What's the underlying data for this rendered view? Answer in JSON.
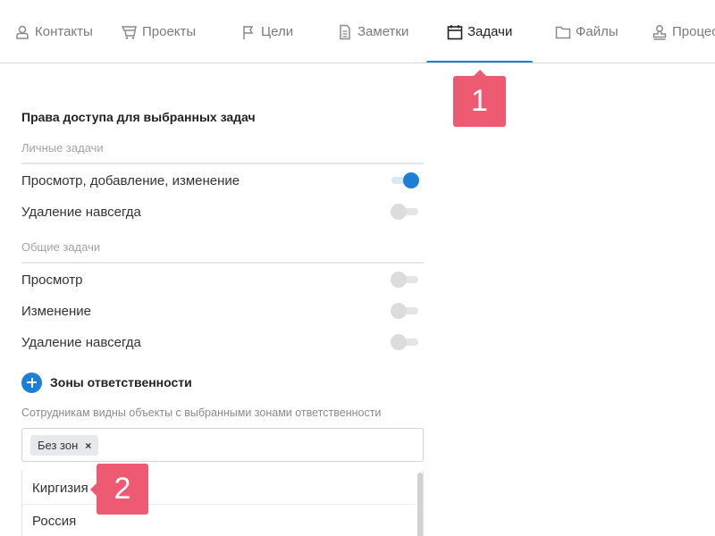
{
  "tabs": [
    {
      "label": "Контакты",
      "icon": "person-stamp-icon"
    },
    {
      "label": "Проекты",
      "icon": "cart-icon"
    },
    {
      "label": "Цели",
      "icon": "flag-icon"
    },
    {
      "label": "Заметки",
      "icon": "note-icon"
    },
    {
      "label": "Задачи",
      "icon": "calendar-icon",
      "active": true
    },
    {
      "label": "Файлы",
      "icon": "folder-icon"
    },
    {
      "label": "Процессы",
      "icon": "stamp-icon"
    }
  ],
  "markers": {
    "one": "1",
    "two": "2"
  },
  "access": {
    "title": "Права доступа для выбранных задач",
    "personal": {
      "label": "Личные задачи",
      "items": [
        {
          "label": "Просмотр, добавление, изменение",
          "on": true
        },
        {
          "label": "Удаление навсегда",
          "on": false
        }
      ]
    },
    "shared": {
      "label": "Общие задачи",
      "items": [
        {
          "label": "Просмотр",
          "on": false
        },
        {
          "label": "Изменение",
          "on": false
        },
        {
          "label": "Удаление навсегда",
          "on": false
        }
      ]
    }
  },
  "zones": {
    "title": "Зоны ответственности",
    "hint": "Сотрудникам видны объекты с выбранными зонами ответственности",
    "selected_chip": "Без зон",
    "chip_remove": "×",
    "options": [
      "Киргизия",
      "Россия"
    ]
  },
  "colors": {
    "accent": "#1e7fd6",
    "marker": "#ef5a73"
  }
}
